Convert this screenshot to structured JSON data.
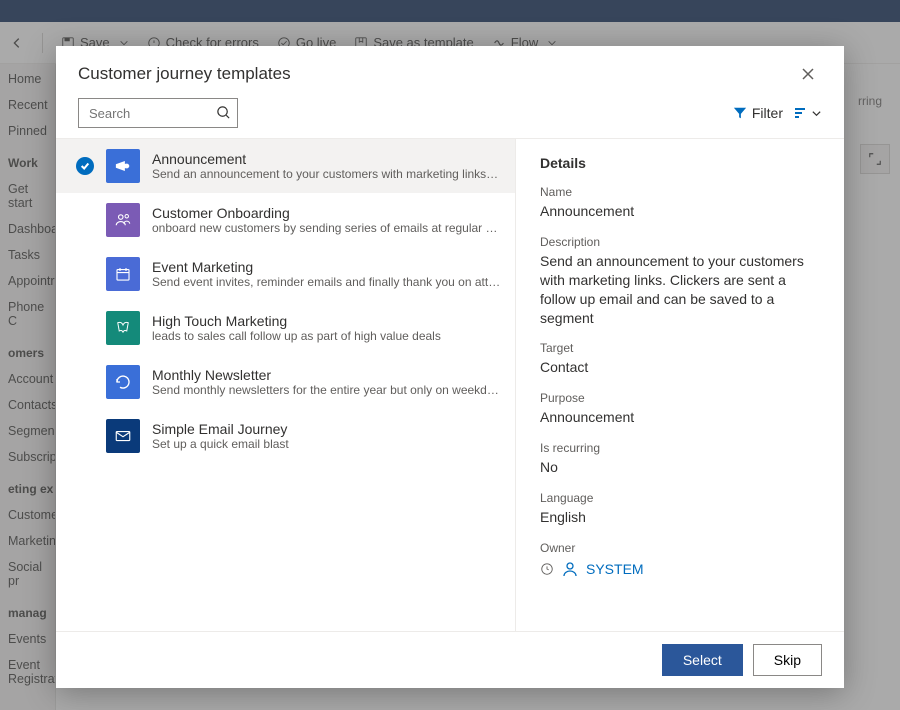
{
  "toolbar": {
    "save": "Save",
    "check_errors": "Check for errors",
    "go_live": "Go live",
    "save_template": "Save as template",
    "flow": "Flow"
  },
  "sidenav": {
    "items_a": [
      "Home",
      "Recent",
      "Pinned"
    ],
    "hdr_work": "Work",
    "items_b": [
      "Get start",
      "Dashboa",
      "Tasks",
      "Appointr",
      "Phone C"
    ],
    "hdr_cust": "omers",
    "items_c": [
      "Account",
      "Contacts",
      "Segmen",
      "Subscrip"
    ],
    "hdr_mkt": "eting ex",
    "items_d": [
      "Custome",
      "Marketin",
      "Social pr"
    ],
    "hdr_mgmt": "manag",
    "items_e": [
      "Events",
      "Event Registrations"
    ]
  },
  "bg_right": {
    "recurring": "rring"
  },
  "modal": {
    "title": "Customer journey templates",
    "search_placeholder": "Search",
    "filter_label": "Filter",
    "select_label": "Select",
    "skip_label": "Skip"
  },
  "templates": [
    {
      "title": "Announcement",
      "desc": "Send an announcement to your customers with marketing links. Clickers are sent a...",
      "color": "#3a6fd8",
      "selected": true
    },
    {
      "title": "Customer Onboarding",
      "desc": "onboard new customers by sending series of emails at regular cadence",
      "color": "#7b5bb5",
      "selected": false
    },
    {
      "title": "Event Marketing",
      "desc": "Send event invites, reminder emails and finally thank you on attending",
      "color": "#4a6bd6",
      "selected": false
    },
    {
      "title": "High Touch Marketing",
      "desc": "leads to sales call follow up as part of high value deals",
      "color": "#148a7a",
      "selected": false
    },
    {
      "title": "Monthly Newsletter",
      "desc": "Send monthly newsletters for the entire year but only on weekday afternoons",
      "color": "#3a6fd8",
      "selected": false
    },
    {
      "title": "Simple Email Journey",
      "desc": "Set up a quick email blast",
      "color": "#0a3a7a",
      "selected": false
    }
  ],
  "details": {
    "heading": "Details",
    "fields": {
      "name_label": "Name",
      "name_value": "Announcement",
      "desc_label": "Description",
      "desc_value": "Send an announcement to your customers with marketing links. Clickers are sent a follow up email and can be saved to a segment",
      "target_label": "Target",
      "target_value": "Contact",
      "purpose_label": "Purpose",
      "purpose_value": "Announcement",
      "recurring_label": "Is recurring",
      "recurring_value": "No",
      "language_label": "Language",
      "language_value": "English",
      "owner_label": "Owner",
      "owner_value": "SYSTEM"
    }
  }
}
